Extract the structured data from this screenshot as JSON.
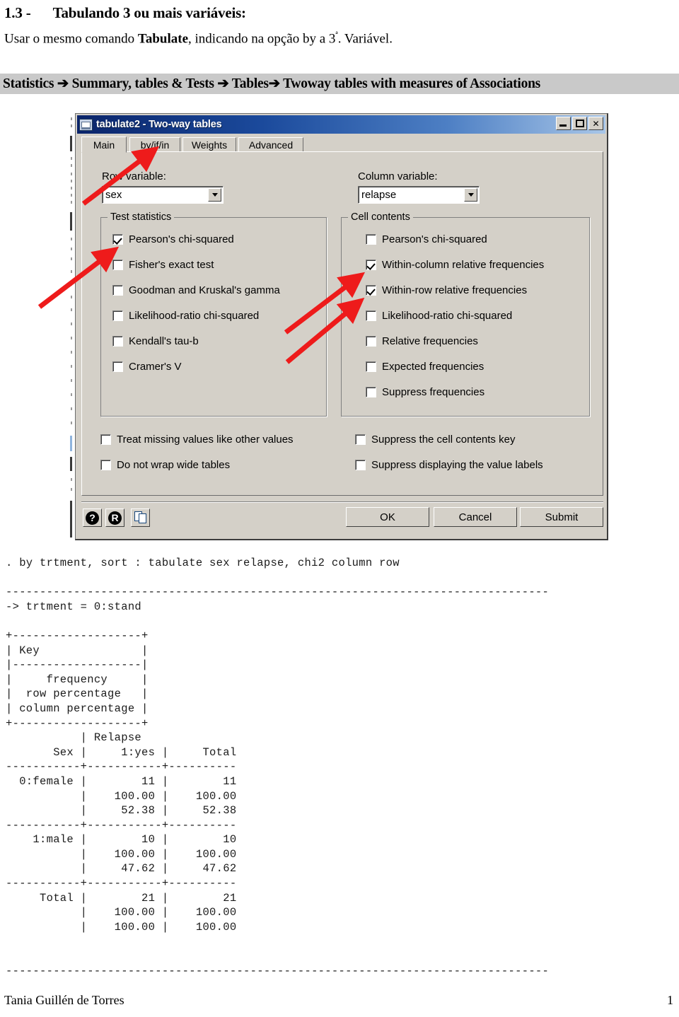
{
  "document": {
    "heading_number": "1.3 -",
    "heading_title": "Tabulando 3 ou mais variáveis:",
    "intro_before": "Usar o mesmo comando ",
    "intro_bold": "Tabulate",
    "intro_after_1": ", indicando na opção by a 3",
    "intro_sup": "ª",
    "intro_after_2": ". Variável.",
    "menu_path": "Statistics ➔ Summary, tables & Tests ➔ Tables➔ Twoway tables with measures of Associations",
    "menu_path_segments": [
      "Statistics",
      "Summary, tables & Tests",
      "Tables",
      "Twoway tables with measures of Associations"
    ],
    "footer_author": "Tania Guillén de Torres",
    "footer_page": "1"
  },
  "dialog": {
    "title": "tabulate2 - Two-way tables",
    "window_buttons": [
      "minimize",
      "maximize",
      "close"
    ],
    "tabs": [
      {
        "label": "Main",
        "active": true
      },
      {
        "label": "by/if/in",
        "active": false
      },
      {
        "label": "Weights",
        "active": false
      },
      {
        "label": "Advanced",
        "active": false
      }
    ],
    "row_variable": {
      "label": "Row variable:",
      "value": "sex"
    },
    "column_variable": {
      "label": "Column variable:",
      "value": "relapse"
    },
    "test_statistics": {
      "title": "Test statistics",
      "items": [
        {
          "label": "Pearson's chi-squared",
          "checked": true
        },
        {
          "label": "Fisher's exact test",
          "checked": false
        },
        {
          "label": "Goodman and Kruskal's gamma",
          "checked": false
        },
        {
          "label": "Likelihood-ratio chi-squared",
          "checked": false
        },
        {
          "label": "Kendall's tau-b",
          "checked": false
        },
        {
          "label": "Cramer's V",
          "checked": false
        }
      ]
    },
    "cell_contents": {
      "title": "Cell contents",
      "items": [
        {
          "label": "Pearson's chi-squared",
          "checked": false
        },
        {
          "label": "Within-column relative frequencies",
          "checked": true
        },
        {
          "label": "Within-row relative frequencies",
          "checked": true
        },
        {
          "label": "Likelihood-ratio chi-squared",
          "checked": false
        },
        {
          "label": "Relative frequencies",
          "checked": false
        },
        {
          "label": "Expected frequencies",
          "checked": false
        },
        {
          "label": "Suppress frequencies",
          "checked": false
        }
      ]
    },
    "options": [
      {
        "label": "Treat missing values like other values",
        "checked": false
      },
      {
        "label": "Do not wrap wide tables",
        "checked": false
      },
      {
        "label": "Suppress the cell contents key",
        "checked": false
      },
      {
        "label": "Suppress displaying the value labels",
        "checked": false
      }
    ],
    "tool_buttons": [
      {
        "name": "help-icon",
        "glyph": "?"
      },
      {
        "name": "reset-icon",
        "glyph": "R"
      },
      {
        "name": "copy-icon",
        "glyph": ""
      }
    ],
    "action_buttons": [
      {
        "label": "OK"
      },
      {
        "label": "Cancel"
      },
      {
        "label": "Submit"
      }
    ],
    "annotation_arrows": [
      {
        "target": "by/if/in tab"
      },
      {
        "target": "Pearson's chi-squared checkbox"
      },
      {
        "target": "Within-column relative frequencies checkbox"
      },
      {
        "target": "Within-row relative frequencies checkbox"
      }
    ]
  },
  "console": {
    "text": ". by trtment, sort : tabulate sex relapse, chi2 column row\n\n--------------------------------------------------------------------------------\n-> trtment = 0:stand\n\n+-------------------+\n| Key               |\n|-------------------|\n|     frequency     |\n|  row percentage   |\n| column percentage |\n+-------------------+\n           | Relapse\n       Sex |     1:yes |     Total\n-----------+-----------+----------\n  0:female |        11 |        11\n           |    100.00 |    100.00\n           |     52.38 |     52.38\n-----------+-----------+----------\n    1:male |        10 |        10\n           |    100.00 |    100.00\n           |     47.62 |     47.62\n-----------+-----------+----------\n     Total |        21 |        21\n           |    100.00 |    100.00\n           |    100.00 |    100.00\n\n\n--------------------------------------------------------------------------------",
    "command": ". by trtment, sort : tabulate sex relapse, chi2 column row",
    "by_group": "-> trtment = 0:stand",
    "key_box_title": "Key",
    "key_box_lines": [
      "frequency",
      "row percentage",
      "column percentage"
    ],
    "table": {
      "column_group_header": "Relapse",
      "row_header": "Sex",
      "columns": [
        "1:yes",
        "Total"
      ],
      "rows": [
        {
          "label": "0:female",
          "frequency": [
            "11",
            "11"
          ],
          "row_percentage": [
            "100.00",
            "100.00"
          ],
          "column_percentage": [
            "52.38",
            "52.38"
          ]
        },
        {
          "label": "1:male",
          "frequency": [
            "10",
            "10"
          ],
          "row_percentage": [
            "100.00",
            "100.00"
          ],
          "column_percentage": [
            "47.62",
            "47.62"
          ]
        },
        {
          "label": "Total",
          "frequency": [
            "21",
            "21"
          ],
          "row_percentage": [
            "100.00",
            "100.00"
          ],
          "column_percentage": [
            "100.00",
            "100.00"
          ]
        }
      ]
    }
  },
  "colors": {
    "dialog_face": "#d4d0c8",
    "titlebar_start": "#0a246a",
    "titlebar_end": "#a8c6e8",
    "menu_band": "#c9c9c9",
    "annotation_red": "#ee1b1b"
  }
}
